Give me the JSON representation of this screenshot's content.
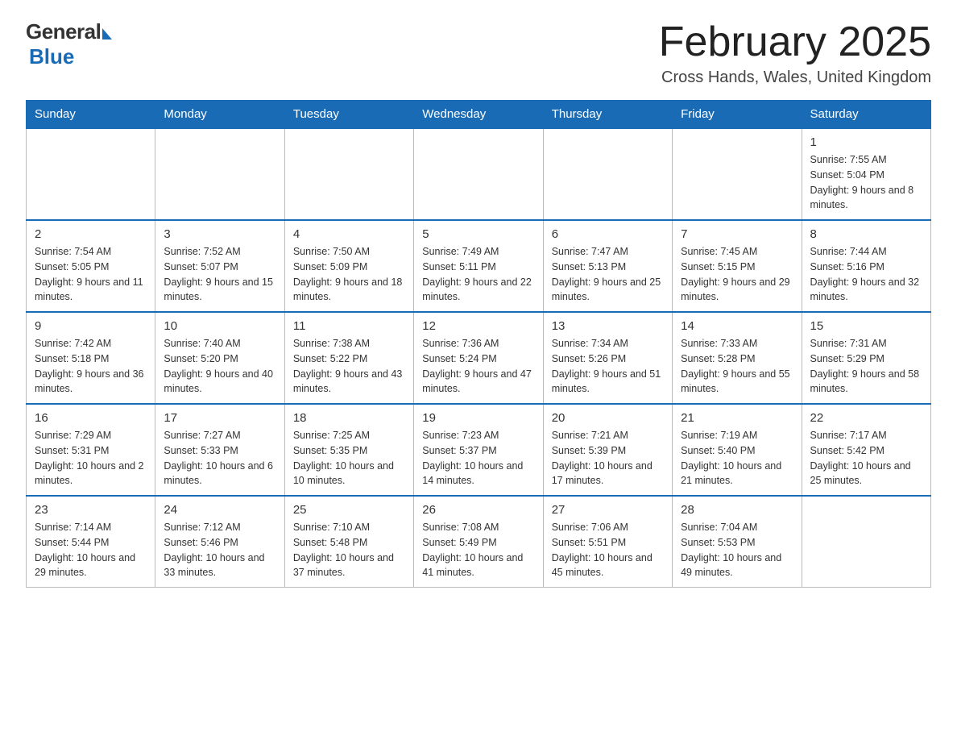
{
  "header": {
    "logo_general": "General",
    "logo_blue": "Blue",
    "month_title": "February 2025",
    "location": "Cross Hands, Wales, United Kingdom"
  },
  "weekdays": [
    "Sunday",
    "Monday",
    "Tuesday",
    "Wednesday",
    "Thursday",
    "Friday",
    "Saturday"
  ],
  "weeks": [
    [
      {
        "day": "",
        "info": ""
      },
      {
        "day": "",
        "info": ""
      },
      {
        "day": "",
        "info": ""
      },
      {
        "day": "",
        "info": ""
      },
      {
        "day": "",
        "info": ""
      },
      {
        "day": "",
        "info": ""
      },
      {
        "day": "1",
        "info": "Sunrise: 7:55 AM\nSunset: 5:04 PM\nDaylight: 9 hours and 8 minutes."
      }
    ],
    [
      {
        "day": "2",
        "info": "Sunrise: 7:54 AM\nSunset: 5:05 PM\nDaylight: 9 hours and 11 minutes."
      },
      {
        "day": "3",
        "info": "Sunrise: 7:52 AM\nSunset: 5:07 PM\nDaylight: 9 hours and 15 minutes."
      },
      {
        "day": "4",
        "info": "Sunrise: 7:50 AM\nSunset: 5:09 PM\nDaylight: 9 hours and 18 minutes."
      },
      {
        "day": "5",
        "info": "Sunrise: 7:49 AM\nSunset: 5:11 PM\nDaylight: 9 hours and 22 minutes."
      },
      {
        "day": "6",
        "info": "Sunrise: 7:47 AM\nSunset: 5:13 PM\nDaylight: 9 hours and 25 minutes."
      },
      {
        "day": "7",
        "info": "Sunrise: 7:45 AM\nSunset: 5:15 PM\nDaylight: 9 hours and 29 minutes."
      },
      {
        "day": "8",
        "info": "Sunrise: 7:44 AM\nSunset: 5:16 PM\nDaylight: 9 hours and 32 minutes."
      }
    ],
    [
      {
        "day": "9",
        "info": "Sunrise: 7:42 AM\nSunset: 5:18 PM\nDaylight: 9 hours and 36 minutes."
      },
      {
        "day": "10",
        "info": "Sunrise: 7:40 AM\nSunset: 5:20 PM\nDaylight: 9 hours and 40 minutes."
      },
      {
        "day": "11",
        "info": "Sunrise: 7:38 AM\nSunset: 5:22 PM\nDaylight: 9 hours and 43 minutes."
      },
      {
        "day": "12",
        "info": "Sunrise: 7:36 AM\nSunset: 5:24 PM\nDaylight: 9 hours and 47 minutes."
      },
      {
        "day": "13",
        "info": "Sunrise: 7:34 AM\nSunset: 5:26 PM\nDaylight: 9 hours and 51 minutes."
      },
      {
        "day": "14",
        "info": "Sunrise: 7:33 AM\nSunset: 5:28 PM\nDaylight: 9 hours and 55 minutes."
      },
      {
        "day": "15",
        "info": "Sunrise: 7:31 AM\nSunset: 5:29 PM\nDaylight: 9 hours and 58 minutes."
      }
    ],
    [
      {
        "day": "16",
        "info": "Sunrise: 7:29 AM\nSunset: 5:31 PM\nDaylight: 10 hours and 2 minutes."
      },
      {
        "day": "17",
        "info": "Sunrise: 7:27 AM\nSunset: 5:33 PM\nDaylight: 10 hours and 6 minutes."
      },
      {
        "day": "18",
        "info": "Sunrise: 7:25 AM\nSunset: 5:35 PM\nDaylight: 10 hours and 10 minutes."
      },
      {
        "day": "19",
        "info": "Sunrise: 7:23 AM\nSunset: 5:37 PM\nDaylight: 10 hours and 14 minutes."
      },
      {
        "day": "20",
        "info": "Sunrise: 7:21 AM\nSunset: 5:39 PM\nDaylight: 10 hours and 17 minutes."
      },
      {
        "day": "21",
        "info": "Sunrise: 7:19 AM\nSunset: 5:40 PM\nDaylight: 10 hours and 21 minutes."
      },
      {
        "day": "22",
        "info": "Sunrise: 7:17 AM\nSunset: 5:42 PM\nDaylight: 10 hours and 25 minutes."
      }
    ],
    [
      {
        "day": "23",
        "info": "Sunrise: 7:14 AM\nSunset: 5:44 PM\nDaylight: 10 hours and 29 minutes."
      },
      {
        "day": "24",
        "info": "Sunrise: 7:12 AM\nSunset: 5:46 PM\nDaylight: 10 hours and 33 minutes."
      },
      {
        "day": "25",
        "info": "Sunrise: 7:10 AM\nSunset: 5:48 PM\nDaylight: 10 hours and 37 minutes."
      },
      {
        "day": "26",
        "info": "Sunrise: 7:08 AM\nSunset: 5:49 PM\nDaylight: 10 hours and 41 minutes."
      },
      {
        "day": "27",
        "info": "Sunrise: 7:06 AM\nSunset: 5:51 PM\nDaylight: 10 hours and 45 minutes."
      },
      {
        "day": "28",
        "info": "Sunrise: 7:04 AM\nSunset: 5:53 PM\nDaylight: 10 hours and 49 minutes."
      },
      {
        "day": "",
        "info": ""
      }
    ]
  ]
}
